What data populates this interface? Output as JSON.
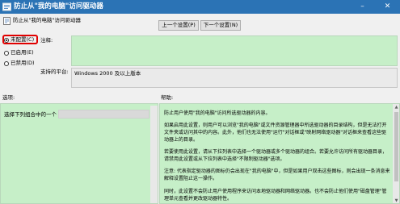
{
  "window": {
    "title": "防止从\"我的电脑\"访问驱动器",
    "minimize_glyph": "–",
    "close_glyph": "✕",
    "icon": "policy-settings-icon"
  },
  "header": {
    "policy_name": "防止从\"我的电脑\"访问驱动器",
    "prev_button": "上一个设置(P)",
    "next_button": "下一个设置(N)"
  },
  "state": {
    "options": [
      {
        "label": "未配置(C)",
        "checked": true
      },
      {
        "label": "已启用(E)",
        "checked": false
      },
      {
        "label": "已禁用(D)",
        "checked": false
      }
    ]
  },
  "comment": {
    "label": "注释:"
  },
  "supported_on": {
    "label": "支持的平台:",
    "value": "Windows 2000 及以上版本"
  },
  "options_panel": {
    "label": "选项:",
    "select_label": "选择下列组合中的一个"
  },
  "help_panel": {
    "label": "帮助:",
    "paragraphs": [
      "防止用户使用\"我的电脑\"访问所选驱动器的内容。",
      "如果启用此设置，则用户可以浏览\"我的电脑\"或文件资源管理器中所选驱动器的目录结构，但是无法打开文件夹或访问其中的内容。此外，他们也无法使用\"运行\"对话框或\"映射网络驱动器\"对话框来查看这些驱动器上的目录。",
      "若要使用此设置，请从下拉列表中选择一个驱动器或多个驱动器的组合。若要允许访问所有驱动器目录，请禁用此设置或从下拉列表中选择\"不限制驱动器\"选项。",
      "注意: 代表指定驱动器的图标仍会出现在\"我的电脑\"中，但是如果用户双击这些图标，则会出现一条消息来解释设置阻止这一操作。",
      "同时，此设置不会防止用户使用程序来访问本地驱动器和网络驱动器。也不会防止他们使用\"磁盘管理\"管理单元查看并更改驱动器特性。"
    ]
  },
  "colors": {
    "titlebar": "#2b73b5",
    "panel_green": "#c6efc8",
    "highlight_red": "#e00000"
  }
}
